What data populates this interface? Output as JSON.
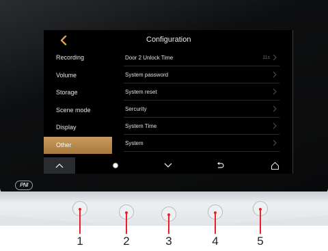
{
  "screen": {
    "title": "Configuration",
    "back_icon": "chevron-left-icon",
    "accent_color": "#e0a050",
    "active_color": "#b88a4c"
  },
  "sidebar": {
    "items": [
      {
        "label": "Recording",
        "active": false
      },
      {
        "label": "Volume",
        "active": false
      },
      {
        "label": "Storage",
        "active": false
      },
      {
        "label": "Scene mode",
        "active": false
      },
      {
        "label": "Display",
        "active": false
      },
      {
        "label": "Other",
        "active": true
      }
    ]
  },
  "settings": {
    "rows": [
      {
        "label": "Door 2 Unlock Time",
        "value": "11s"
      },
      {
        "label": "System  password",
        "value": ""
      },
      {
        "label": "System reset",
        "value": ""
      },
      {
        "label": "Sercurity",
        "value": ""
      },
      {
        "label": "System Time",
        "value": ""
      },
      {
        "label": "System",
        "value": ""
      }
    ]
  },
  "bottom_nav": {
    "buttons": [
      "chevron-up-icon",
      "chevron-down-icon",
      "return-icon",
      "home-icon"
    ]
  },
  "device": {
    "logo_text": "PNI",
    "hardware_keys": [
      "1",
      "2",
      "3",
      "4",
      "5"
    ],
    "callout_color": "#e8202a"
  }
}
